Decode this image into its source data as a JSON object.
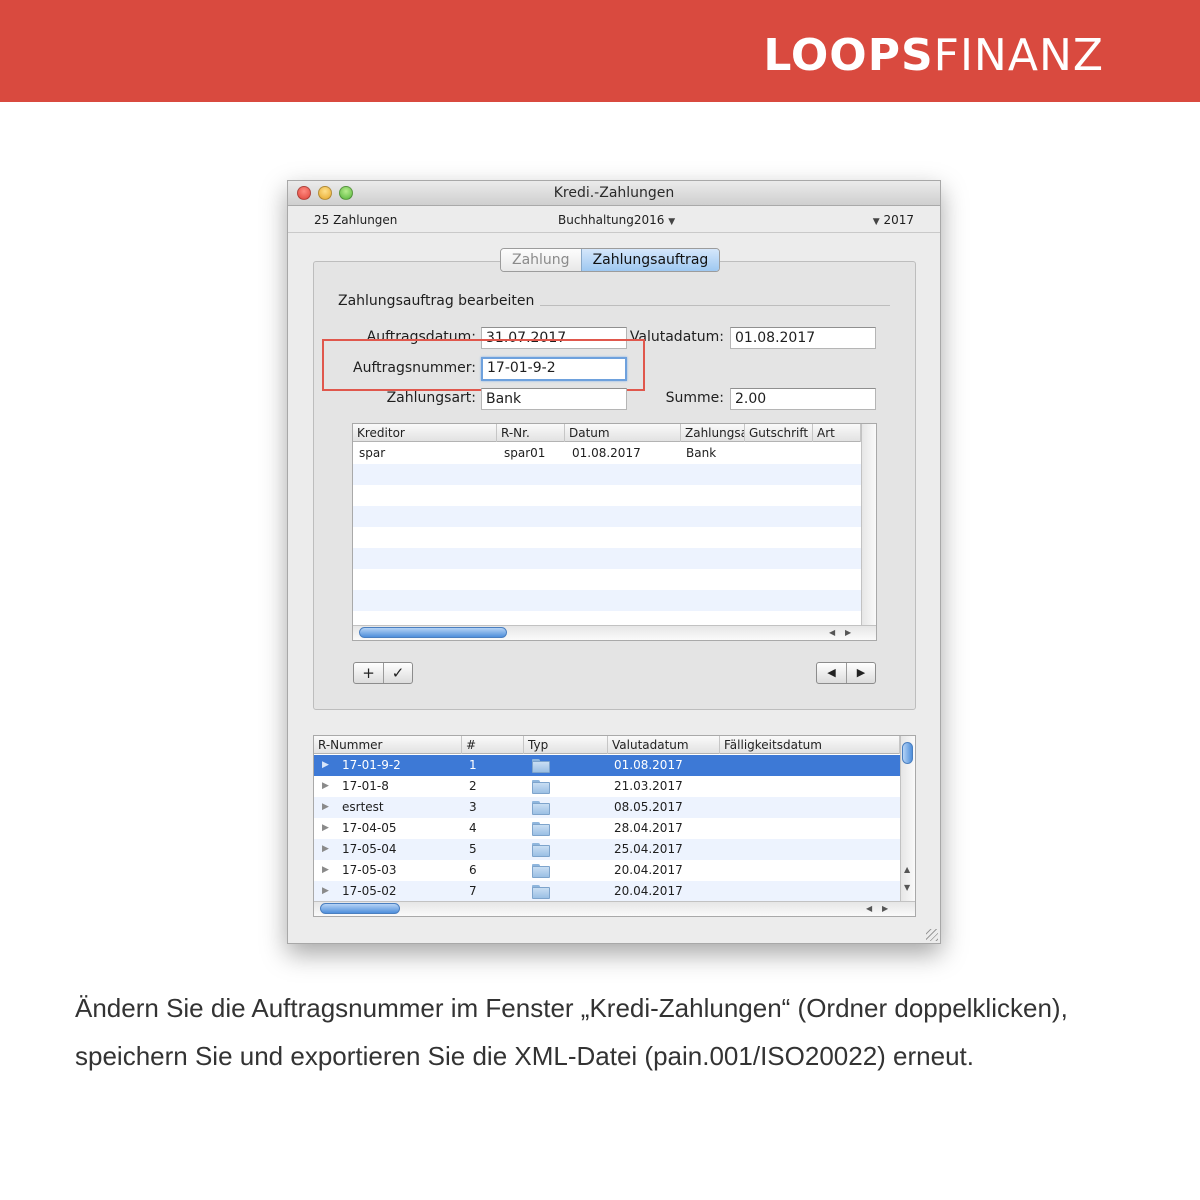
{
  "brand": {
    "bold": "LOOPS",
    "light": "FINANZ"
  },
  "window": {
    "title": "Kredi.-Zahlungen",
    "count": "25 Zahlungen",
    "book": "Buchhaltung2016",
    "year": "2017"
  },
  "tabs": {
    "t1": "Zahlung",
    "t2": "Zahlungsauftrag"
  },
  "form": {
    "section": "Zahlungsauftrag bearbeiten",
    "auftragsdatum_label": "Auftragsdatum:",
    "auftragsdatum": "31.07.2017",
    "valutadatum_label": "Valutadatum:",
    "valutadatum": "01.08.2017",
    "auftragsnummer_label": "Auftragsnummer:",
    "auftragsnummer": "17-01-9-2",
    "zahlungsart_label": "Zahlungsart:",
    "zahlungsart": "Bank",
    "summe_label": "Summe:",
    "summe": "2.00"
  },
  "detail_table": {
    "headers": {
      "kreditor": "Kreditor",
      "rnr": "R-Nr.",
      "datum": "Datum",
      "zahlungsart": "Zahlungsa",
      "gutschrift": "Gutschrift",
      "art": "Art"
    },
    "rows": [
      {
        "kreditor": "spar",
        "rnr": "spar01",
        "datum": "01.08.2017",
        "zahlungsart": "Bank"
      }
    ]
  },
  "list_table": {
    "headers": {
      "rnummer": "R-Nummer",
      "num": "#",
      "typ": "Typ",
      "valutadatum": "Valutadatum",
      "faellig": "Fälligkeitsdatum"
    },
    "rows": [
      {
        "rnummer": "17-01-9-2",
        "num": "1",
        "valutadatum": "01.08.2017"
      },
      {
        "rnummer": "17-01-8",
        "num": "2",
        "valutadatum": "21.03.2017"
      },
      {
        "rnummer": "esrtest",
        "num": "3",
        "valutadatum": "08.05.2017"
      },
      {
        "rnummer": "17-04-05",
        "num": "4",
        "valutadatum": "28.04.2017"
      },
      {
        "rnummer": "17-05-04",
        "num": "5",
        "valutadatum": "25.04.2017"
      },
      {
        "rnummer": "17-05-03",
        "num": "6",
        "valutadatum": "20.04.2017"
      },
      {
        "rnummer": "17-05-02",
        "num": "7",
        "valutadatum": "20.04.2017"
      }
    ]
  },
  "buttons": {
    "add": "+",
    "confirm": "✓",
    "prev": "◀",
    "next": "▶"
  },
  "caption": {
    "line1": "Ändern Sie die Auftragsnummer im Fenster „Kredi-Zahlungen“ (Ordner doppelklicken),",
    "line2": "speichern Sie und exportieren Sie die XML-Datei (pain.001/ISO20022) erneut."
  },
  "colors": {
    "banner": "#d94a3f",
    "selection": "#3d79d6",
    "highlight": "#e0574c"
  }
}
